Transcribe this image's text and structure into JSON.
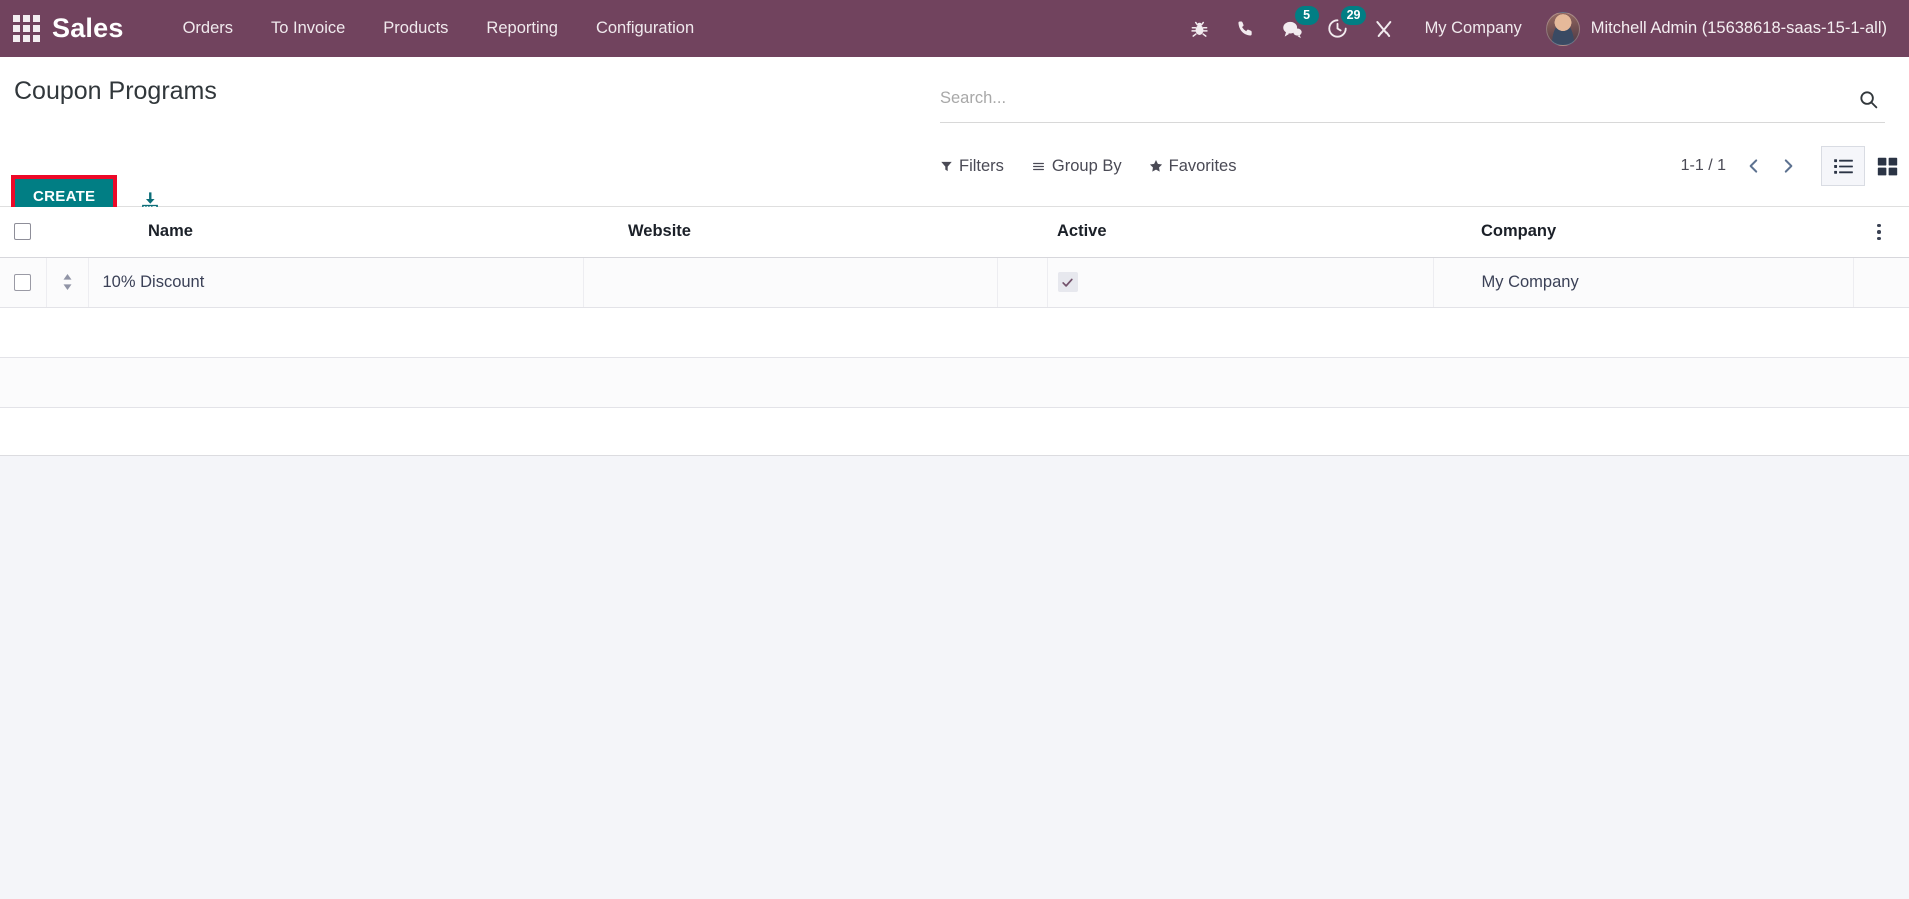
{
  "navbar": {
    "apps_icon": "apps-grid-icon",
    "brand": "Sales",
    "menu": [
      {
        "label": "Orders"
      },
      {
        "label": "To Invoice"
      },
      {
        "label": "Products"
      },
      {
        "label": "Reporting"
      },
      {
        "label": "Configuration"
      }
    ],
    "systray": [
      {
        "icon": "bug-icon",
        "name": "debug-menu",
        "badge": null
      },
      {
        "icon": "phone-icon",
        "name": "voip-phone",
        "badge": null
      },
      {
        "icon": "chat-bubble-icon",
        "name": "messages-menu",
        "badge": "5"
      },
      {
        "icon": "clock-icon",
        "name": "activities-menu",
        "badge": "29"
      },
      {
        "icon": "wrench-icon",
        "name": "tools-menu",
        "badge": null
      }
    ],
    "company": "My Company",
    "user_name": "Mitchell Admin (15638618-saas-15-1-all)",
    "avatar": "user-avatar",
    "bg_color": "#71435E",
    "badge_color": "#017E84"
  },
  "control_panel": {
    "title": "Coupon Programs",
    "create_label": "CREATE",
    "create_color": "#017E84",
    "highlight_color": "#EC0928",
    "import_icon": "import-download-icon",
    "search": {
      "placeholder": "Search...",
      "value": "",
      "icon": "search-icon"
    },
    "filters": [
      {
        "label": "Filters",
        "icon": "funnel-icon"
      },
      {
        "label": "Group By",
        "icon": "hamburger-icon"
      },
      {
        "label": "Favorites",
        "icon": "star-icon"
      }
    ],
    "pager": {
      "count": "1-1 / 1",
      "prev_icon": "chevron-left-icon",
      "next_icon": "chevron-right-icon"
    },
    "views": [
      {
        "name": "list-view",
        "icon": "list-icon",
        "active": true
      },
      {
        "name": "kanban-view",
        "icon": "grid-icon",
        "active": false
      }
    ]
  },
  "list": {
    "columns": [
      {
        "key": "name",
        "label": "Name"
      },
      {
        "key": "website",
        "label": "Website"
      },
      {
        "key": "active",
        "label": "Active"
      },
      {
        "key": "company",
        "label": "Company"
      }
    ],
    "optional_columns_icon": "vertical-dots-icon",
    "rows": [
      {
        "name": "10% Discount",
        "website": "",
        "active": true,
        "company": "My Company",
        "selected": false
      }
    ]
  }
}
